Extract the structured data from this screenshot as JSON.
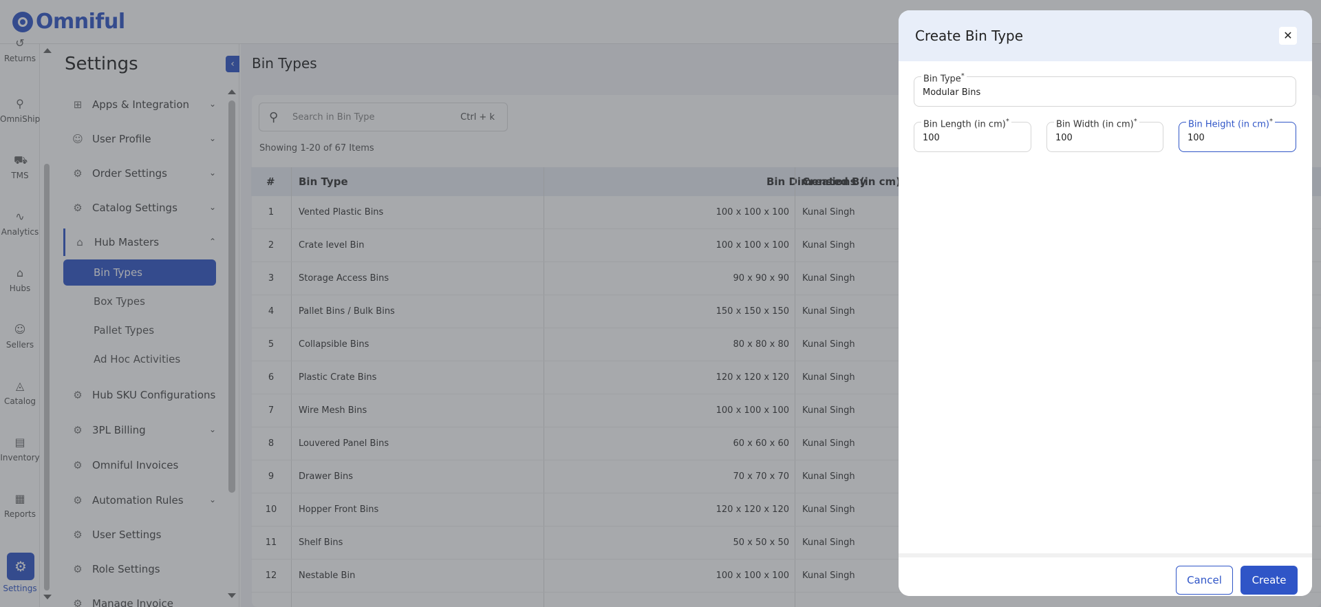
{
  "brand": {
    "name": "Omniful",
    "accent": "#2f55c7"
  },
  "rail": {
    "items": [
      {
        "label": "Returns",
        "icon": "returns-icon",
        "glyph": "↺"
      },
      {
        "label": "OmniShip",
        "icon": "omniship-icon",
        "glyph": "⚲"
      },
      {
        "label": "TMS",
        "icon": "truck-icon",
        "glyph": "⛟"
      },
      {
        "label": "Analytics",
        "icon": "analytics-icon",
        "glyph": "∿"
      },
      {
        "label": "Hubs",
        "icon": "hub-icon",
        "glyph": "⌂"
      },
      {
        "label": "Sellers",
        "icon": "user-icon",
        "glyph": "☺"
      },
      {
        "label": "Catalog",
        "icon": "catalog-icon",
        "glyph": "◬"
      },
      {
        "label": "Inventory",
        "icon": "inventory-icon",
        "glyph": "▤"
      },
      {
        "label": "Reports",
        "icon": "reports-icon",
        "glyph": "▦"
      }
    ],
    "settings": {
      "label": "Settings",
      "glyph": "⚙"
    }
  },
  "menu": {
    "title": "Settings",
    "items": [
      {
        "label": "Apps & Integration",
        "glyph": "⊞",
        "chevron": "⌄"
      },
      {
        "label": "User Profile",
        "glyph": "☺",
        "chevron": "⌄"
      },
      {
        "label": "Order Settings",
        "glyph": "⚙",
        "chevron": "⌄"
      },
      {
        "label": "Catalog Settings",
        "glyph": "⚙",
        "chevron": "⌄"
      },
      {
        "label": "Hub Masters",
        "glyph": "⌂",
        "chevron": "⌃"
      }
    ],
    "sub_items": [
      "Bin Types",
      "Box Types",
      "Pallet Types",
      "Ad Hoc Activities"
    ],
    "items_after": [
      {
        "label": "Hub SKU Configurations",
        "glyph": "⚙",
        "chevron": ""
      },
      {
        "label": "3PL Billing",
        "glyph": "⚙",
        "chevron": "⌄"
      },
      {
        "label": "Omniful Invoices",
        "glyph": "⚙",
        "chevron": ""
      },
      {
        "label": "Automation Rules",
        "glyph": "⚙",
        "chevron": "⌄"
      },
      {
        "label": "User Settings",
        "glyph": "⚙",
        "chevron": ""
      },
      {
        "label": "Role Settings",
        "glyph": "⚙",
        "chevron": ""
      },
      {
        "label": "Manage Invoice",
        "glyph": "⚙",
        "chevron": ""
      }
    ],
    "collapse_glyph": "‹"
  },
  "page": {
    "title": "Bin Types",
    "search_placeholder": "Search in Bin Type",
    "search_shortcut": "Ctrl + k",
    "showing": "Showing 1-20 of 67 Items"
  },
  "table": {
    "headers": [
      "#",
      "Bin Type",
      "Bin Dimensions (in cm)",
      "Created By"
    ],
    "rows": [
      [
        "1",
        "Vented Plastic Bins",
        "100 x 100 x 100",
        "Kunal Singh"
      ],
      [
        "2",
        "Crate level Bin",
        "100 x 100 x 100",
        "Kunal Singh"
      ],
      [
        "3",
        "Storage Access Bins",
        "90 x 90 x 90",
        "Kunal Singh"
      ],
      [
        "4",
        "Pallet Bins / Bulk Bins",
        "150 x 150 x 150",
        "Kunal Singh"
      ],
      [
        "5",
        "Collapsible Bins",
        "80 x 80 x 80",
        "Kunal Singh"
      ],
      [
        "6",
        "Plastic Crate Bins",
        "120 x 120 x 120",
        "Kunal Singh"
      ],
      [
        "7",
        "Wire Mesh Bins",
        "100 x 100 x 100",
        "Kunal Singh"
      ],
      [
        "8",
        "Louvered Panel Bins",
        "60 x 60 x 60",
        "Kunal Singh"
      ],
      [
        "9",
        "Drawer Bins",
        "70 x 70 x 70",
        "Kunal Singh"
      ],
      [
        "10",
        "Hopper Front Bins",
        "120 x 120 x 120",
        "Kunal Singh"
      ],
      [
        "11",
        "Shelf Bins",
        "50 x 50 x 50",
        "Kunal Singh"
      ],
      [
        "12",
        "Nestable Bin",
        "100 x 100 x 100",
        "Kunal Singh"
      ]
    ]
  },
  "modal": {
    "title": "Create Bin Type",
    "close_glyph": "✕",
    "fields": {
      "bin_type": {
        "label": "Bin Type",
        "value": "Modular Bins"
      },
      "length": {
        "label": "Bin Length (in cm)",
        "value": "100"
      },
      "width": {
        "label": "Bin Width (in cm)",
        "value": "100"
      },
      "height": {
        "label": "Bin Height (in cm)",
        "value": "100"
      }
    },
    "required_mark": "*",
    "cancel_label": "Cancel",
    "create_label": "Create"
  }
}
